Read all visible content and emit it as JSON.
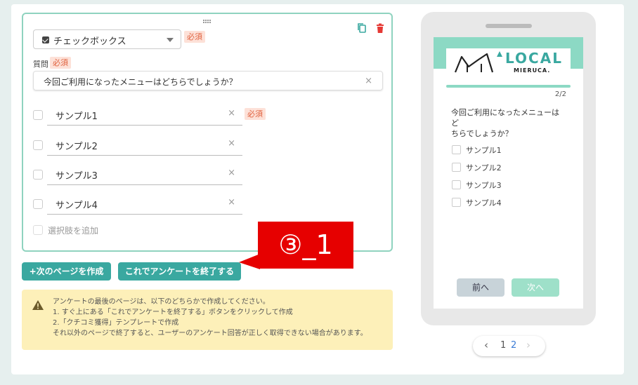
{
  "editor": {
    "question_type": "チェックボックス",
    "required_badge": "必須",
    "question_label": "質問",
    "question_text": "今回ご利用になったメニューはどちらでしょうか？",
    "clear_glyph": "×",
    "options": [
      {
        "label": "サンプル1",
        "required": true
      },
      {
        "label": "サンプル2",
        "required": false
      },
      {
        "label": "サンプル3",
        "required": false
      },
      {
        "label": "サンプル4",
        "required": false
      }
    ],
    "add_option_label": "選択肢を追加"
  },
  "actions": {
    "next_page_label": "+次のページを作成",
    "finish_label": "これでアンケートを終了する"
  },
  "annotation": {
    "text": "③_1"
  },
  "notice": {
    "lines": [
      "アンケートの最後のページは、以下のどちらかで作成してください。",
      "1. すぐ上にある「これでアンケートを終了する」ボタンをクリックして作成",
      "2.「クチコミ獲得」テンプレートで作成",
      "それ以外のページで終了すると、ユーザーのアンケート回答が正しく取得できない場合があります。"
    ]
  },
  "preview": {
    "logo_main": "LOCAL",
    "logo_sub": "MIERUCA.",
    "progress_value": 1.0,
    "page_counter": "2/2",
    "question_line1": "今回ご利用になったメニューはど",
    "question_line2": "ちらでしょうか？",
    "options": [
      "サンプル1",
      "サンプル2",
      "サンプル3",
      "サンプル4"
    ],
    "prev_label": "前へ",
    "next_label": "次へ"
  },
  "pager": {
    "prev": "‹",
    "pages": [
      "1",
      "2"
    ],
    "current": "2",
    "next": "›"
  },
  "colors": {
    "accent": "#3aa8a0",
    "card_border": "#8fd3bf",
    "required_bg": "#fde1d8",
    "required_text": "#e0623f",
    "annotation_red": "#e60000",
    "notice_bg": "#fdf0b9",
    "preview_band": "#8cd9c4"
  }
}
